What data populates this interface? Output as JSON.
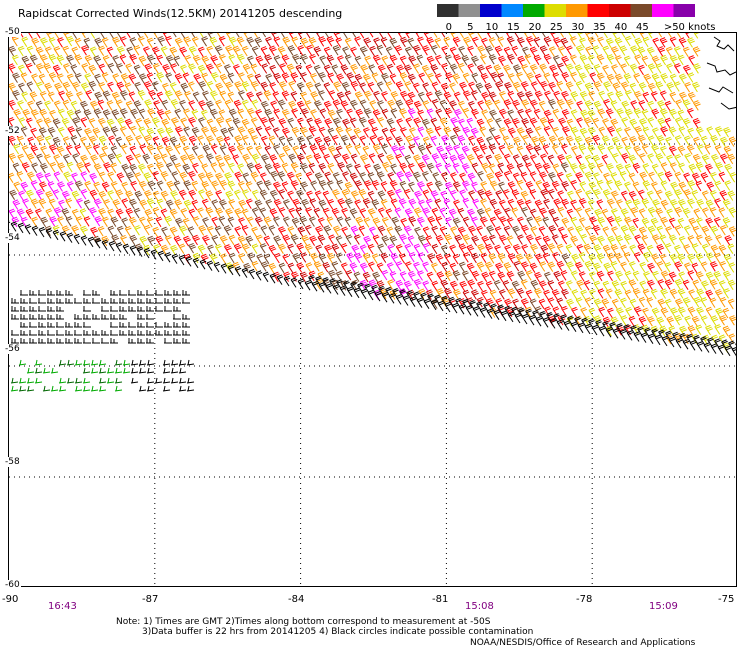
{
  "title": "Rapidscat Corrected Winds(12.5KM) 20141205 descending",
  "colorbar": {
    "tick_labels": [
      "0",
      "5",
      "10",
      "15",
      "20",
      "25",
      "30",
      "35",
      "40",
      "45",
      ">50 knots"
    ],
    "colors": [
      "#303030",
      "#909090",
      "#0000cc",
      "#0088ff",
      "#00aa00",
      "#dddd00",
      "#ff9900",
      "#ff0000",
      "#cc0000",
      "#7a4a2a",
      "#ff00ff",
      "#8800aa"
    ]
  },
  "axes": {
    "lat_labels": [
      "-50",
      "-52",
      "-54",
      "-56",
      "-58",
      "-60"
    ],
    "lon_labels": [
      "-90",
      "-87",
      "-84",
      "-81",
      "-78",
      "-75"
    ],
    "lat_range": [
      -60,
      -50
    ],
    "lon_range": [
      -90,
      -75
    ],
    "grid": "dotted"
  },
  "time_labels": [
    {
      "text": "16:43",
      "lon": -88.5
    },
    {
      "text": "15:08",
      "lon": -79.5
    },
    {
      "text": "15:09",
      "lon": -76.5
    }
  ],
  "notes": [
    "Note: 1) Times are GMT 2)Times along bottom correspond to measurement at -50S",
    "3)Data buffer is 22 hrs from 20141205 4) Black circles indicate possible contamination"
  ],
  "credit": "NOAA/NESDIS/Office of Research and Applications",
  "colors": {
    "time_label": "#800080",
    "grid": "#000000"
  }
}
